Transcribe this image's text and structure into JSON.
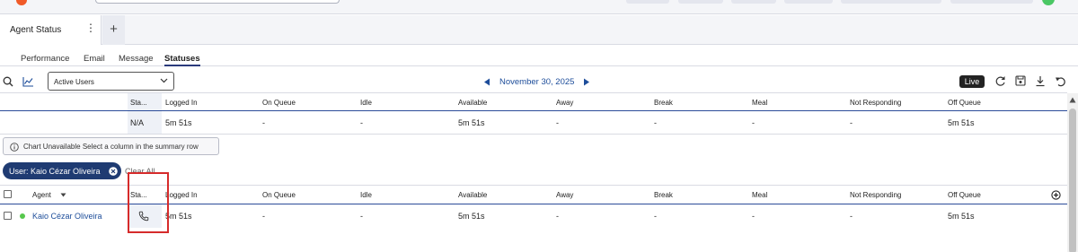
{
  "colors": {
    "brand_orange": "#f05a28",
    "nav_blue": "#1d4d9a",
    "chip_navy": "#1f3b72",
    "online_green": "#57c84d",
    "highlight_red": "#d62b2b"
  },
  "workspace_tab": {
    "title": "Agent Status",
    "menu_icon": "vertical-ellipsis-icon",
    "add_icon": "plus-icon"
  },
  "subtabs": [
    "Performance",
    "Email",
    "Message",
    "Statuses"
  ],
  "active_subtab": "Statuses",
  "toolbar": {
    "filter_select": "Active Users",
    "date": "November 30, 2025",
    "live_label": "Live",
    "icons": [
      "search-icon",
      "chart-icon",
      "refresh-icon",
      "save-icon",
      "download-icon",
      "undo-icon"
    ]
  },
  "summary": {
    "headers": [
      "Sta...",
      "Logged In",
      "On Queue",
      "Idle",
      "Available",
      "Away",
      "Break",
      "Meal",
      "Not Responding",
      "Off Queue"
    ],
    "values": [
      "N/A",
      "5m 51s",
      "-",
      "-",
      "5m 51s",
      "-",
      "-",
      "-",
      "-",
      "5m 51s"
    ]
  },
  "chart_note": "Chart Unavailable Select a column in the summary row",
  "filter_chip": "User: Kaio Cézar Oliveira",
  "clear_all": "Clear All",
  "agents_table": {
    "agent_header": "Agent",
    "headers": [
      "Sta...",
      "Logged In",
      "On Queue",
      "Idle",
      "Available",
      "Away",
      "Break",
      "Meal",
      "Not Responding",
      "Off Queue"
    ],
    "rows": [
      {
        "name": "Kaio Cézar Oliveira",
        "status_icon": "phone-icon",
        "values": [
          "5m 51s",
          "-",
          "-",
          "5m 51s",
          "-",
          "-",
          "-",
          "-",
          "5m 51s"
        ]
      }
    ]
  }
}
